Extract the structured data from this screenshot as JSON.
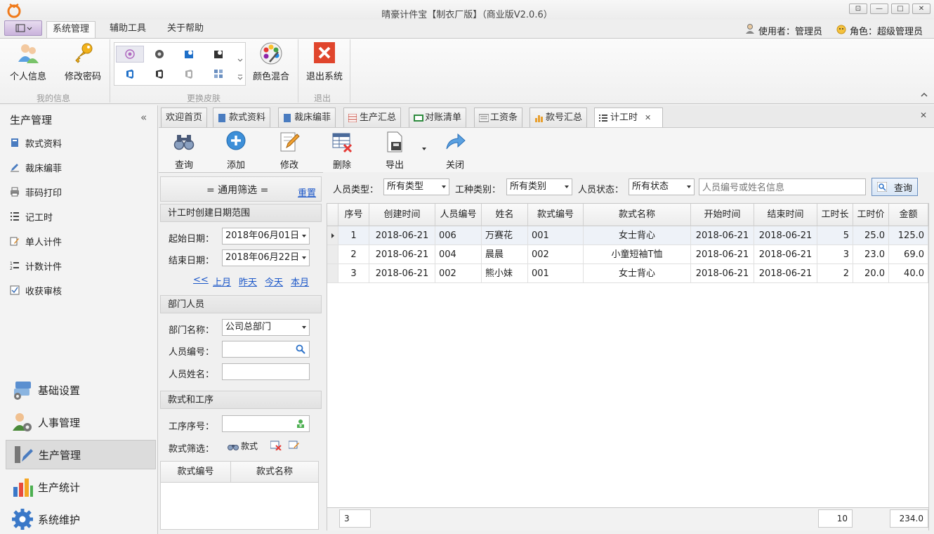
{
  "window": {
    "title": "晴豪计件宝【制衣厂版】（商业版V2.0.6）",
    "controls": [
      "⊡",
      "—",
      "□",
      "✕"
    ]
  },
  "menu": {
    "tabs": [
      "系统管理",
      "辅助工具",
      "关于帮助"
    ],
    "active": "系统管理",
    "user_label": "使用者：管理员",
    "role_label": "角色：超级管理员"
  },
  "ribbon": {
    "profile_label": "个人信息",
    "password_label": "修改密码",
    "group_myinfo": "我的信息",
    "color_mix_label": "颜色混合",
    "group_skin": "更换皮肤",
    "exit_label": "退出系统",
    "group_exit": "退出"
  },
  "sidebar": {
    "title": "生产管理",
    "collapse": "«",
    "items": [
      "款式资料",
      "裁床编菲",
      "菲码打印",
      "记工时",
      "单人计件",
      "计数计件",
      "收获审核"
    ],
    "modules": [
      "基础设置",
      "人事管理",
      "生产管理",
      "生产统计",
      "系统维护"
    ],
    "active_module": "生产管理"
  },
  "tabs": {
    "items": [
      "欢迎首页",
      "款式资料",
      "裁床编菲",
      "生产汇总",
      "对账清单",
      "工资条",
      "款号汇总",
      "计工时"
    ],
    "active": "计工时",
    "close": "✕"
  },
  "toolbar": {
    "query": "查询",
    "add": "添加",
    "edit": "修改",
    "delete": "删除",
    "export": "导出",
    "close": "关闭"
  },
  "filter": {
    "header": "= 通用筛选 =",
    "reset": "重置",
    "date_section": "计工时创建日期范围",
    "start_label": "起始日期：",
    "start_value": "2018年06月01日",
    "end_label": "结束日期：",
    "end_value": "2018年06月22日",
    "quick_links": [
      "<<",
      "上月",
      "昨天",
      "今天",
      "本月"
    ],
    "dept_section": "部门人员",
    "dept_label": "部门名称：",
    "dept_value": "公司总部门",
    "emp_no_label": "人员编号：",
    "emp_name_label": "人员姓名：",
    "style_section": "款式和工序",
    "process_label": "工序序号：",
    "style_filter_label": "款式筛选：",
    "style_btn": "款式",
    "style_cols": [
      "款式编号",
      "款式名称"
    ]
  },
  "search": {
    "emp_type_label": "人员类型：",
    "emp_type_value": "所有类型",
    "work_type_label": "工种类别：",
    "work_type_value": "所有类别",
    "emp_status_label": "人员状态：",
    "emp_status_value": "所有状态",
    "placeholder": "人员编号或姓名信息",
    "button": "查询"
  },
  "grid": {
    "columns": [
      "序号",
      "创建时间",
      "人员编号",
      "姓名",
      "款式编号",
      "款式名称",
      "开始时间",
      "结束时间",
      "工时长",
      "工时价",
      "金额"
    ],
    "rows": [
      [
        "1",
        "2018-06-21",
        "006",
        "万赛花",
        "001",
        "女士背心",
        "2018-06-21",
        "2018-06-21",
        "5",
        "25.0",
        "125.0"
      ],
      [
        "2",
        "2018-06-21",
        "004",
        "晨晨",
        "002",
        "小童短袖T恤",
        "2018-06-21",
        "2018-06-21",
        "3",
        "23.0",
        "69.0"
      ],
      [
        "3",
        "2018-06-21",
        "002",
        "熊小妹",
        "001",
        "女士背心",
        "2018-06-21",
        "2018-06-21",
        "2",
        "20.0",
        "40.0"
      ]
    ],
    "footer_count": "3",
    "footer_hours": "10",
    "footer_amount": "234.0"
  }
}
